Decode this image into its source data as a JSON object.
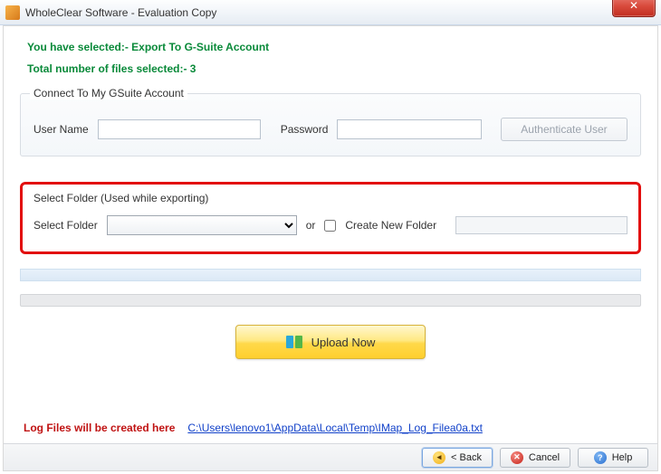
{
  "window": {
    "title": "WholeClear Software - Evaluation Copy"
  },
  "summary": {
    "selected_line": "You have selected:- Export To G-Suite Account",
    "total_files_line": "Total number of files selected:- 3"
  },
  "connect": {
    "legend": "Connect To My GSuite Account",
    "user_label": "User Name",
    "user_value": "",
    "pass_label": "Password",
    "pass_value": "",
    "auth_label": "Authenticate User"
  },
  "folder": {
    "legend": "Select Folder (Used while exporting)",
    "select_label": "Select Folder",
    "select_value": "",
    "or_label": "or",
    "create_label": "Create New Folder",
    "create_checked": false,
    "new_name_value": ""
  },
  "upload": {
    "label": "Upload Now"
  },
  "log": {
    "label": "Log Files will be created here",
    "path": "C:\\Users\\lenovo1\\AppData\\Local\\Temp\\IMap_Log_Filea0a.txt"
  },
  "footer": {
    "back": "< Back",
    "cancel": "Cancel",
    "help": "Help"
  }
}
